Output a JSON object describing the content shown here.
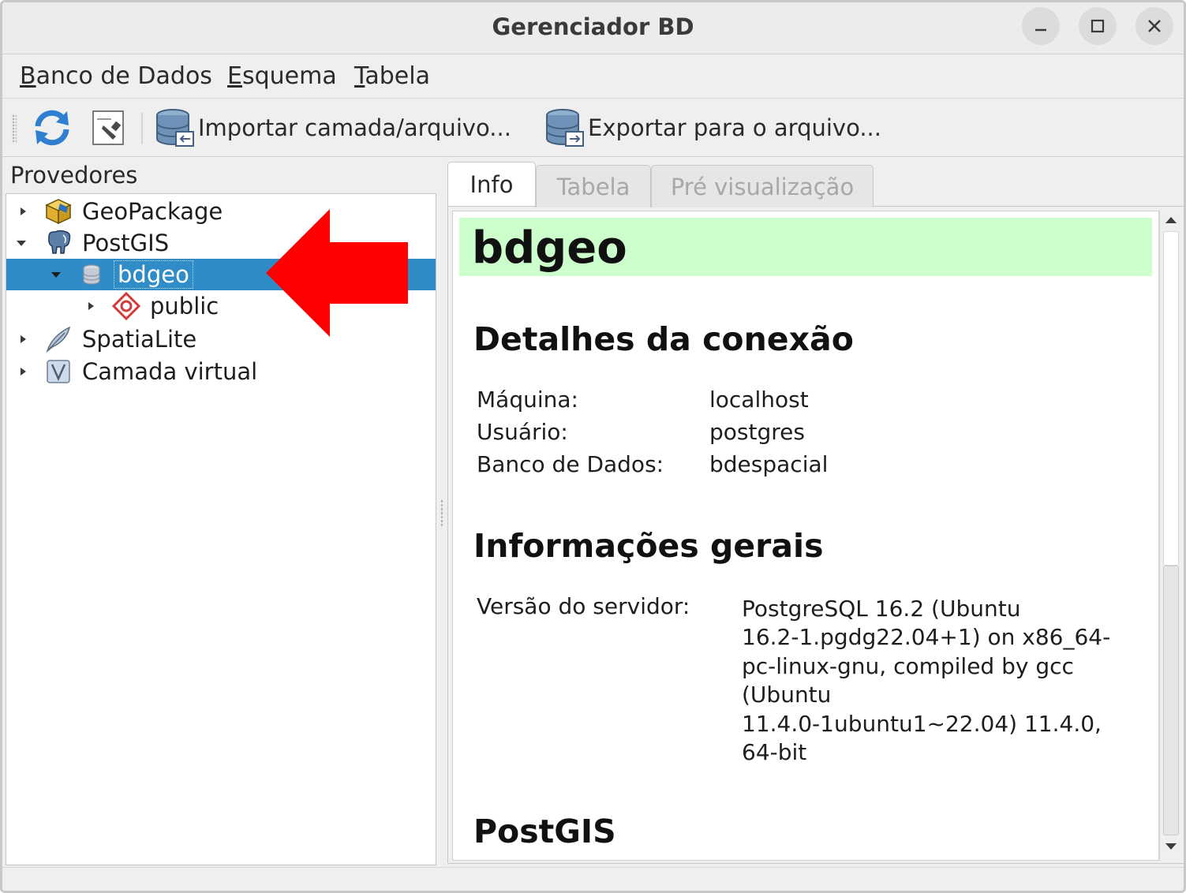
{
  "window": {
    "title": "Gerenciador BD"
  },
  "menubar": {
    "items": [
      {
        "mnemonic": "B",
        "rest": "anco de Dados"
      },
      {
        "mnemonic": "E",
        "rest": "squema"
      },
      {
        "mnemonic": "T",
        "rest": "abela"
      }
    ]
  },
  "toolbar": {
    "refresh_icon": "refresh-icon",
    "sql_icon": "sql-window-icon",
    "import_label": "Importar camada/arquivo...",
    "export_label": "Exportar para o arquivo..."
  },
  "providers": {
    "label": "Provedores",
    "tree": [
      {
        "label": "GeoPackage",
        "icon": "geopackage-icon",
        "expanded": false
      },
      {
        "label": "PostGIS",
        "icon": "postgis-elephant-icon",
        "expanded": true
      },
      {
        "label": "bdgeo",
        "icon": "database-icon",
        "expanded": true,
        "selected": true
      },
      {
        "label": "public",
        "icon": "schema-icon",
        "expanded": false
      },
      {
        "label": "SpatiaLite",
        "icon": "spatialite-feather-icon",
        "expanded": false
      },
      {
        "label": "Camada virtual",
        "icon": "virtual-layer-icon",
        "expanded": false
      }
    ]
  },
  "tabs": [
    {
      "label": "Info",
      "active": true
    },
    {
      "label": "Tabela",
      "active": false
    },
    {
      "label": "Pré visualização",
      "active": false
    }
  ],
  "info": {
    "db_name": "bdgeo",
    "connection_heading": "Detalhes da conexão",
    "connection": [
      {
        "key": "Máquina:",
        "value": "localhost"
      },
      {
        "key": "Usuário:",
        "value": "postgres"
      },
      {
        "key": "Banco de Dados:",
        "value": "bdespacial"
      }
    ],
    "general_heading": "Informações gerais",
    "server_version_key": "Versão do servidor:",
    "server_version_lines": [
      "PostgreSQL 16.2 (Ubuntu",
      "16.2-1.pgdg22.04+1) on x86_64-",
      "pc-linux-gnu, compiled by gcc",
      "(Ubuntu",
      "11.4.0-1ubuntu1~22.04) 11.4.0,",
      "64-bit"
    ],
    "postgis_heading": "PostGIS"
  },
  "colors": {
    "selection": "#308cc6",
    "db_header_bg": "#ccffcc",
    "annotation_arrow": "#ff0000"
  }
}
